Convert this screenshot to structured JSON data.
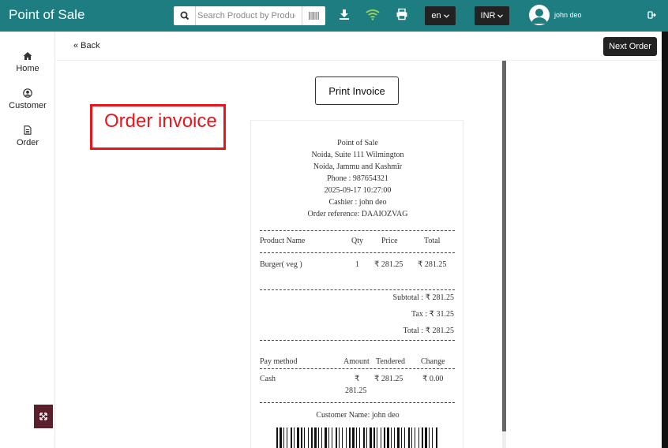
{
  "header": {
    "brand": "Point of Sale",
    "search_placeholder": "Search Product by Product",
    "language": "en",
    "currency": "INR",
    "user_name": "john deo"
  },
  "sidebar": {
    "items": [
      {
        "label": "Home",
        "icon": "home-icon"
      },
      {
        "label": "Customer",
        "icon": "user-icon"
      },
      {
        "label": "Order",
        "icon": "document-icon"
      }
    ]
  },
  "toolbar": {
    "back_label": "« Back",
    "next_order_label": "Next Order"
  },
  "content": {
    "print_label": "Print Invoice",
    "annotation": "Order invoice"
  },
  "receipt": {
    "store_name": "Point of Sale",
    "address_1": "Noida, Suite 111 Wilmington",
    "address_2": "Noida, Jammu and Kashmīr",
    "phone": "Phone : 987654321",
    "datetime": "2025-09-17 10:27:00",
    "cashier": "Cashier : john deo",
    "order_ref": "Order reference: DAAIOZVAG",
    "columns": {
      "name": "Product Name",
      "qty": "Qty",
      "price": "Price",
      "total": "Total"
    },
    "items": [
      {
        "name": "Burger( veg )",
        "qty": "1",
        "price": "₹ 281.25",
        "total": "₹ 281.25"
      }
    ],
    "subtotal": "Subtotal : ₹ 281.25",
    "tax": "Tax :   ₹ 31.25",
    "total": "Total : ₹ 281.25",
    "pay_columns": {
      "method": "Pay method",
      "amount": "Amount",
      "tendered": "Tendered",
      "change": "Change"
    },
    "payments": [
      {
        "method": "Cash",
        "amount_symbol": "₹",
        "amount_value": "281.25",
        "tendered": "₹ 281.25",
        "change": "₹ 0.00"
      }
    ],
    "customer": "Customer Name: john deo"
  },
  "colors": {
    "header_bg": "#1d7d80",
    "annotation": "#e8151b",
    "dark_button": "#222222"
  }
}
